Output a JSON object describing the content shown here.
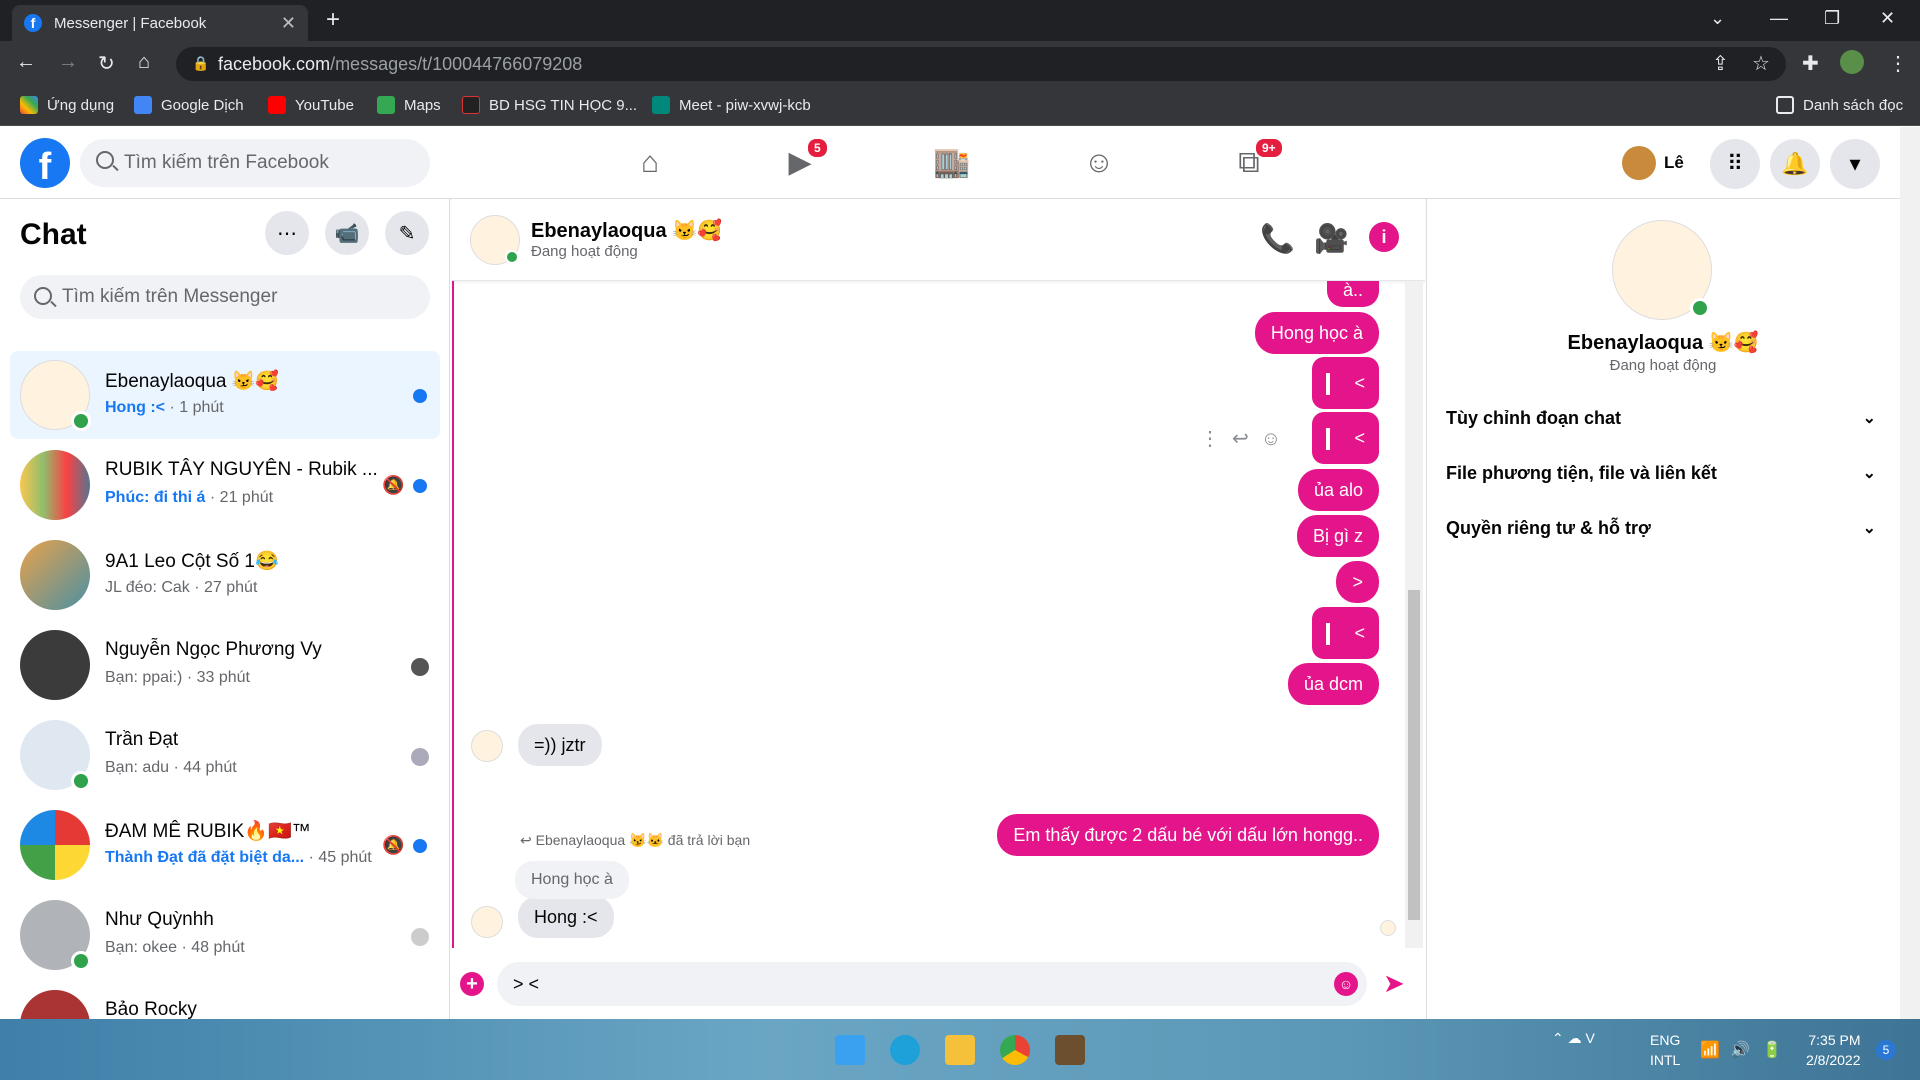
{
  "browser": {
    "tab_title": "Messenger | Facebook",
    "url_host": "facebook.com",
    "url_path": "/messages/t/100044766079208",
    "bookmarks": [
      "Ứng dụng",
      "Google Dịch",
      "YouTube",
      "Maps",
      "BD HSG TIN HỌC 9...",
      "Meet - piw-xvwj-kcb"
    ],
    "reading_list": "Danh sách đọc"
  },
  "fb": {
    "search_placeholder": "Tìm kiếm trên Facebook",
    "watch_badge": "5",
    "gaming_badge": "9+",
    "user_name": "Lê"
  },
  "sidebar": {
    "title": "Chat",
    "search_placeholder": "Tìm kiếm trên Messenger",
    "conversations": [
      {
        "name": "Ebenaylaoqua 😼🥰",
        "sender": "Hong :<",
        "time": " · 1 phút"
      },
      {
        "name": "RUBIK TÂY NGUYÊN - Rubik ...",
        "sender": "Phúc: đi thi á",
        "time": " · 21 phút"
      },
      {
        "name": "9A1 Leo Cột Số 1😂",
        "sender": "JL đéo: Cak",
        "time": " · 27 phút"
      },
      {
        "name": "Nguyễn Ngọc Phương Vy",
        "sender": "Bạn: ppai:)",
        "time": " · 33 phút"
      },
      {
        "name": "Trần Đạt",
        "sender": "Bạn: adu",
        "time": " · 44 phút"
      },
      {
        "name": "ĐAM MÊ RUBIK🔥🇻🇳™",
        "sender": "Thành Đạt đã đặt biệt da...",
        "time": " · 45 phút"
      },
      {
        "name": "Như Quỳnhh",
        "sender": "Bạn: okee",
        "time": " · 48 phút"
      },
      {
        "name": "Bảo Rocky",
        "sender": "",
        "time": ""
      }
    ]
  },
  "chat": {
    "name": "Ebenaylaoqua 😼🥰",
    "status": "Đang hoạt động",
    "messages": {
      "m0": "à..",
      "m1": "Hong học à",
      "m2": "<",
      "m3": "<",
      "m4": "ủa alo",
      "m5": "Bị gì z",
      "m6": ">",
      "m7": "<",
      "m8": "ủa dcm",
      "t1": "=)) jztr",
      "m9": "Em thấy được 2 dấu bé với dấu lớn hongg..",
      "reply_note": "Ebenaylaoqua 😼🐱 đã trả lời bạn",
      "reply_quote": "Hong học à",
      "t2": "Hong :<"
    },
    "composer_text": "> <"
  },
  "info_panel": {
    "name": "Ebenaylaoqua 😼🥰",
    "status": "Đang hoạt động",
    "items": [
      "Tùy chỉnh đoạn chat",
      "File phương tiện, file và liên kết",
      "Quyền riêng tư & hỗ trợ"
    ]
  },
  "taskbar": {
    "lang1": "ENG",
    "lang2": "INTL",
    "time": "7:35 PM",
    "date": "2/8/2022",
    "notif": "5"
  },
  "colors": {
    "accent": "#e4158a",
    "fb_blue": "#1877f2",
    "online": "#31a24c"
  }
}
